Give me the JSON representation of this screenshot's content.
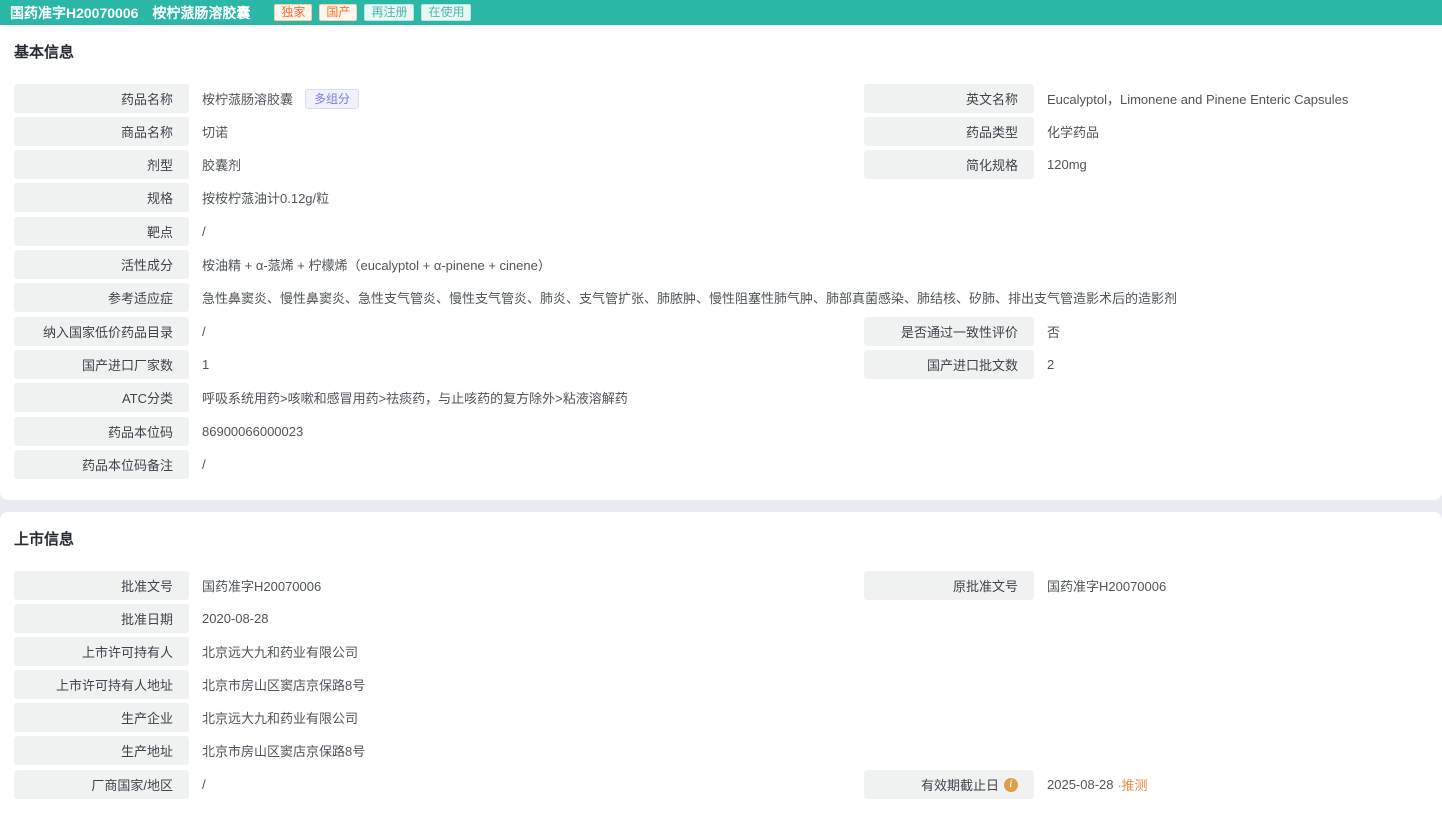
{
  "header": {
    "approval_no": "国药准字H20070006",
    "drug_name": "桉柠蒎肠溶胶囊",
    "badges": [
      {
        "label": "独家",
        "style": "orange"
      },
      {
        "label": "国产",
        "style": "orange"
      },
      {
        "label": "再注册",
        "style": "teal"
      },
      {
        "label": "在使用",
        "style": "teal"
      }
    ]
  },
  "basic_info": {
    "title": "基本信息",
    "drug_name": {
      "label": "药品名称",
      "value": "桉柠蒎肠溶胶囊",
      "tag": "多组分"
    },
    "english_name": {
      "label": "英文名称",
      "value": "Eucalyptol，Limonene and Pinene Enteric Capsules"
    },
    "trade_name": {
      "label": "商品名称",
      "value": "切诺"
    },
    "drug_type": {
      "label": "药品类型",
      "value": "化学药品"
    },
    "dosage_form": {
      "label": "剂型",
      "value": "胶囊剂"
    },
    "simplified_spec": {
      "label": "简化规格",
      "value": "120mg"
    },
    "spec": {
      "label": "规格",
      "value": "按桉柠蒎油计0.12g/粒"
    },
    "target": {
      "label": "靶点",
      "value": "/"
    },
    "active_ingredient": {
      "label": "活性成分",
      "value": "桉油精 + α-蒎烯 + 柠檬烯（eucalyptol + α-pinene + cinene）"
    },
    "indications": {
      "label": "参考适应症",
      "value": "急性鼻窦炎、慢性鼻窦炎、急性支气管炎、慢性支气管炎、肺炎、支气管扩张、肺脓肿、慢性阻塞性肺气肿、肺部真菌感染、肺结核、矽肺、排出支气管造影术后的造影剂"
    },
    "low_price_list": {
      "label": "纳入国家低价药品目录",
      "value": "/"
    },
    "consistency_eval": {
      "label": "是否通过一致性评价",
      "value": "否"
    },
    "manufacturer_count": {
      "label": "国产进口厂家数",
      "value": "1"
    },
    "approval_count": {
      "label": "国产进口批文数",
      "value": "2"
    },
    "atc": {
      "label": "ATC分类",
      "value": "呼吸系统用药>咳嗽和感冒用药>祛痰药，与止咳药的复方除外>粘液溶解药"
    },
    "standard_code": {
      "label": "药品本位码",
      "value": "86900066000023"
    },
    "standard_code_note": {
      "label": "药品本位码备注",
      "value": "/"
    }
  },
  "market_info": {
    "title": "上市信息",
    "approval_no": {
      "label": "批准文号",
      "value": "国药准字H20070006"
    },
    "original_approval_no": {
      "label": "原批准文号",
      "value": "国药准字H20070006"
    },
    "approval_date": {
      "label": "批准日期",
      "value": "2020-08-28"
    },
    "mah": {
      "label": "上市许可持有人",
      "value": "北京远大九和药业有限公司"
    },
    "mah_address": {
      "label": "上市许可持有人地址",
      "value": "北京市房山区窦店京保路8号"
    },
    "manufacturer": {
      "label": "生产企业",
      "value": "北京远大九和药业有限公司"
    },
    "manufacture_address": {
      "label": "生产地址",
      "value": "北京市房山区窦店京保路8号"
    },
    "origin_country": {
      "label": "厂商国家/地区",
      "value": "/"
    },
    "expiry_date": {
      "label": "有效期截止日",
      "value": "2025-08-28",
      "suffix": " ·推测"
    }
  },
  "colors": {
    "header_bg": "#2ab7a5",
    "badge_orange_text": "#ff6b2b",
    "badge_teal_text": "#4fb8ab",
    "tag_purple_text": "#7c80dd",
    "accent_orange": "#ed8b43",
    "label_cell_bg": "#f0f2f2",
    "section_gap_bg": "#e9ebf1"
  }
}
